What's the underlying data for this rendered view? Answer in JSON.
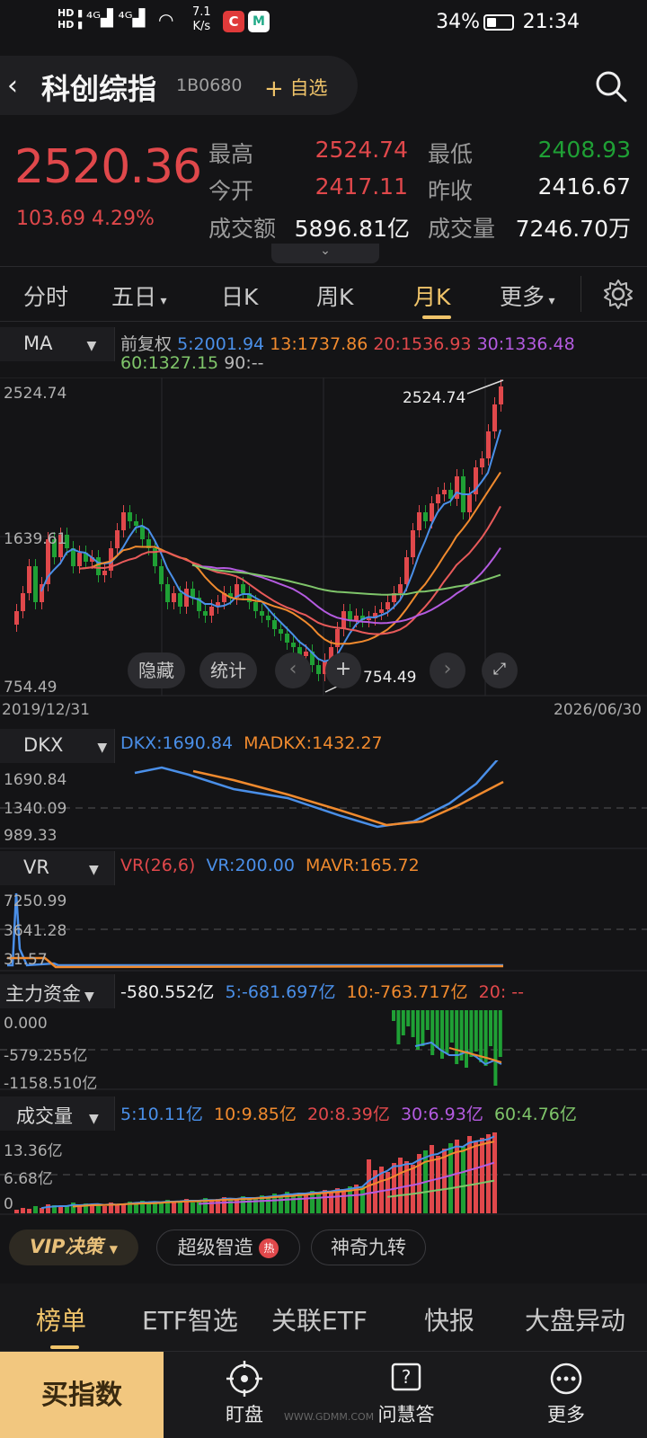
{
  "status_bar": {
    "net_speed": "7.1",
    "net_speed_unit": "K/s",
    "battery": "34%",
    "time": "21:34"
  },
  "header": {
    "title": "科创综指",
    "code": "1B0680",
    "add_watchlist": "自选"
  },
  "quote": {
    "price": "2520.36",
    "change": "103.69",
    "change_pct": "4.29%",
    "high_label": "最高",
    "high": "2524.74",
    "low_label": "最低",
    "low": "2408.93",
    "open_label": "今开",
    "open": "2417.11",
    "prev_close_label": "昨收",
    "prev_close": "2416.67",
    "turnover_label": "成交额",
    "turnover": "5896.81亿",
    "volume_label": "成交量",
    "volume": "7246.70万"
  },
  "tabs": [
    "分时",
    "五日",
    "日K",
    "周K",
    "月K",
    "更多"
  ],
  "active_tab": "月K",
  "main_chart": {
    "indicator": "MA",
    "adjust": "前复权",
    "ma5": "5:2001.94",
    "ma13": "13:1737.86",
    "ma20": "20:1536.93",
    "ma30": "30:1336.48",
    "ma60": "60:1327.15",
    "ma90": "90:--",
    "y_top": "2524.74",
    "y_mid": "1639.61",
    "y_bottom": "754.49",
    "max_marker": "2524.74",
    "min_marker": "754.49",
    "date_start": "2019/12/31",
    "date_end": "2026/06/30",
    "hide_btn": "隐藏",
    "stats_btn": "统计"
  },
  "dkx": {
    "label": "DKX",
    "dkx": "DKX:1690.84",
    "madkx": "MADKX:1432.27",
    "y_top": "1690.84",
    "y_mid": "1340.09",
    "y_bottom": "989.33"
  },
  "vr": {
    "label": "VR",
    "params": "VR(26,6)",
    "vr": "VR:200.00",
    "mavr": "MAVR:165.72",
    "y_top": "7250.99",
    "y_mid": "3641.28",
    "y_bottom": "31.57"
  },
  "main_funds": {
    "label": "主力资金",
    "value": "-580.552亿",
    "ma5": "5:-681.697亿",
    "ma10": "10:-763.717亿",
    "ma20": "20: --",
    "y_top": "0.000",
    "y_mid": "-579.255亿",
    "y_bottom": "-1158.510亿"
  },
  "volume": {
    "label": "成交量",
    "ma5": "5:10.11亿",
    "ma10": "10:9.85亿",
    "ma20": "20:8.39亿",
    "ma30": "30:6.93亿",
    "ma60": "60:4.76亿",
    "y_top": "13.36亿",
    "y_mid": "6.68亿",
    "y_bottom": "0"
  },
  "feature_chips": {
    "vip": "VIP决策",
    "smart": "超级智造",
    "hot": "热",
    "nine": "神奇九转"
  },
  "bottom_tabs": [
    "榜单",
    "ETF智选",
    "关联ETF",
    "快报",
    "大盘异动"
  ],
  "footer": {
    "buy": "买指数",
    "watch": "盯盘",
    "ask": "问慧答",
    "more": "更多",
    "watermark": "WWW.GDMM.COM"
  },
  "colors": {
    "up": "#e0484b",
    "down": "#1fa035",
    "accent": "#f0c46a",
    "ma5": "#4a8fe8",
    "ma13": "#f08a2e",
    "ma20": "#e85a5a",
    "ma30": "#b45be0",
    "ma60": "#7fc56a"
  }
}
